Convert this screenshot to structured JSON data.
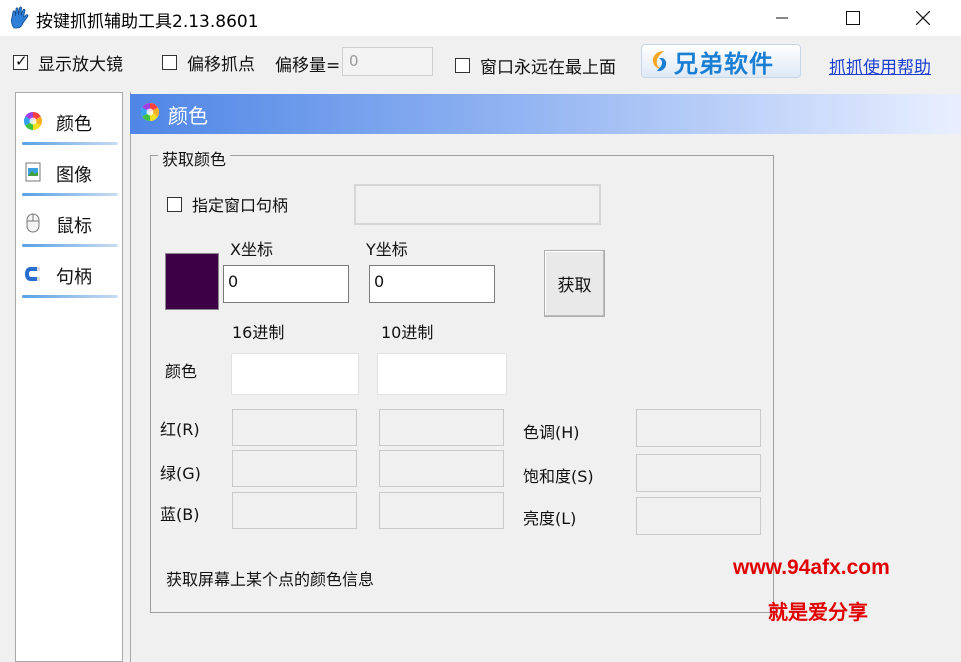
{
  "window": {
    "title": "按键抓抓辅助工具2.13.8601"
  },
  "toolbar": {
    "show_magnifier": {
      "label": "显示放大镜",
      "checked": true
    },
    "offset_point": {
      "label": "偏移抓点",
      "checked": false
    },
    "offset_amount_label": "偏移量=",
    "offset_amount_value": "0",
    "always_on_top": {
      "label": "窗口永远在最上面",
      "checked": false
    },
    "brand_text": "兄弟软件",
    "help_link": "抓抓使用帮助"
  },
  "sidebar": {
    "items": [
      {
        "label": "颜色",
        "icon": "color-wheel-icon"
      },
      {
        "label": "图像",
        "icon": "image-icon"
      },
      {
        "label": "鼠标",
        "icon": "mouse-icon"
      },
      {
        "label": "句柄",
        "icon": "magnet-icon"
      }
    ]
  },
  "panel": {
    "header_title": "颜色",
    "group_title": "获取颜色",
    "specify_handle": {
      "label": "指定窗口句柄",
      "checked": false
    },
    "handle_value": "",
    "x_label": "X坐标",
    "y_label": "Y坐标",
    "x_value": "0",
    "y_value": "0",
    "get_button": "获取",
    "hex_label": "16进制",
    "dec_label": "10进制",
    "color_label": "颜色",
    "swatch_color": "#3d0046",
    "red_label": "红(R)",
    "green_label": "绿(G)",
    "blue_label": "蓝(B)",
    "hue_label": "色调(H)",
    "saturation_label": "饱和度(S)",
    "lightness_label": "亮度(L)",
    "description": "获取屏幕上某个点的颜色信息"
  },
  "watermark": {
    "line1": "www.94afx.com",
    "line2": "就是爱分享"
  }
}
